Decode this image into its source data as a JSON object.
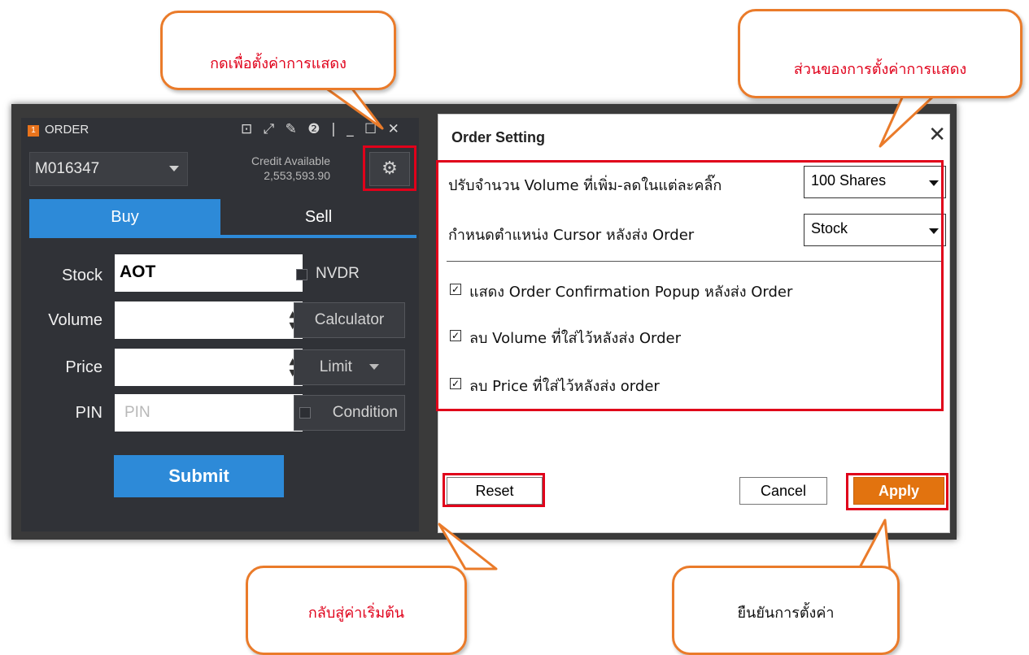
{
  "callouts": {
    "top_left": "กดเพื่อตั้งค่าการแสดง",
    "top_right": "ส่วนของการตั้งค่าการแสดง",
    "bottom_left": "กลับสู่ค่าเริ่มต้น",
    "bottom_right": "ยืนยันการตั้งค่า"
  },
  "order_panel": {
    "badge": "1",
    "title": "ORDER",
    "title_icons": "⊡ ⤢ ✎ ❷ | _ ☐ ✕",
    "account": "M016347",
    "credit_label": "Credit Available",
    "credit_value": "2,553,593.90",
    "gear_icon": "⚙",
    "tabs": {
      "buy": "Buy",
      "sell": "Sell"
    },
    "stock_label": "Stock",
    "stock_value": "AOT",
    "nvdr_label": "NVDR",
    "volume_label": "Volume",
    "calculator_label": "Calculator",
    "price_label": "Price",
    "limit_label": "Limit",
    "pin_label": "PIN",
    "pin_placeholder": "PIN",
    "condition_label": "Condition",
    "submit_label": "Submit"
  },
  "settings_dialog": {
    "title": "Order Setting",
    "close": "✕",
    "volume_step_label": "ปรับจำนวน Volume ที่เพิ่ม-ลดในแต่ละคลิ๊ก",
    "volume_step_value": "100 Shares",
    "cursor_label": "กำหนดตำแหน่ง Cursor หลังส่ง Order",
    "cursor_value": "Stock",
    "options": [
      {
        "label": "แสดง Order Confirmation Popup หลังส่ง Order",
        "checked": true
      },
      {
        "label": "ลบ Volume ที่ใส่ไว้หลังส่ง Order",
        "checked": true
      },
      {
        "label": "ลบ Price ที่ใส่ไว้หลังส่ง order",
        "checked": true
      }
    ],
    "check_mark": "✓",
    "reset_label": "Reset",
    "cancel_label": "Cancel",
    "apply_label": "Apply"
  },
  "colors": {
    "accent_blue": "#2d8ad8",
    "apply_orange": "#e2730f",
    "highlight_red": "#e0001a",
    "callout_border": "#ea7b2a"
  }
}
